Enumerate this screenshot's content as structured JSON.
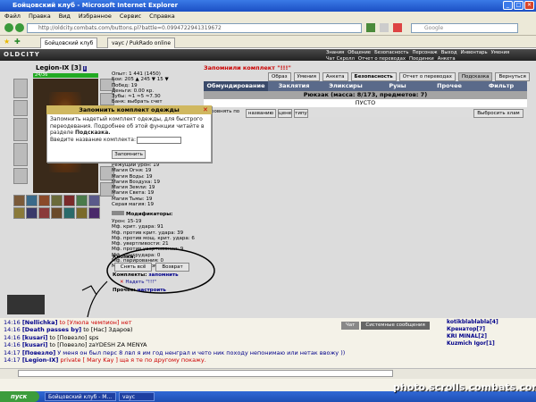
{
  "window": {
    "title": "Бойцовский клуб - Microsoft Internet Explorer"
  },
  "menu": [
    "Файл",
    "Правка",
    "Вид",
    "Избранное",
    "Сервис",
    "Справка"
  ],
  "address": {
    "url": "http://oldcity.combats.com/buttons.pl?battle=0.0994722941319672"
  },
  "search": {
    "placeholder": "Google"
  },
  "browser_tabs": [
    "Бойцовский клуб",
    "vayc / PukRado online"
  ],
  "logo": "OLDCITY",
  "game_nav": [
    "Знания",
    "Общение",
    "Безопасность",
    "Персонаж",
    "Выход",
    "Инвентарь",
    "Умения",
    "Чат Скролл",
    "Отчет о переводах",
    "Поединки",
    "Анкета"
  ],
  "character": {
    "name": "Legion-IX",
    "level": "[3]",
    "hp": "24/36",
    "stats": [
      "Опыт: 1 441 (1450)",
      "Бои: 205 ▲ 245 ▼ 15 ▼",
      "Побед: 19",
      "Деньги: 0.00 кр.",
      "Зубы: ≈1 ≈5 ≈7.30"
    ],
    "bank": "Банк: выбрать счет"
  },
  "stats2": [
    "Режущий урон: 19",
    "Магия Огня: 19",
    "Магия Воды: 19",
    "Магия Воздуха: 19",
    "Магия Земли: 19",
    "Магия Света: 19",
    "Магия Тьмы: 19",
    "Серая магия: 19"
  ],
  "mods_label": "Модификаторы:",
  "mods": [
    "Урон: 15-19",
    "Мф. крит. удара: 91",
    "Мф. против крит. удара: 39",
    "Мф. против мощ. крит. удара: 6",
    "Мф. увертливости: 21",
    "Мф. против увертывания: 9",
    "Мф. контрудара: 0",
    "Мф. парирования: 0",
    "Мф. блока щитом: 0"
  ],
  "kit": {
    "buttons_label": "Кнопки:",
    "undress_all": "Снять всё",
    "return": "Возврат",
    "kits_label": "Комплекты:",
    "remember": "запомнить",
    "wear": "Надеть \"!!!\"",
    "other_label": "Прочее:",
    "settings": "настроить"
  },
  "top_buttons": [
    "Образ",
    "Умения",
    "Анкета",
    "Безопасность",
    "Отчет о переводах",
    "Подсказка",
    "Вернуться"
  ],
  "saved_msg": "Запомнили комплект \"!!!\"",
  "inv_tabs": [
    "Обмундирование",
    "Заклятия",
    "Эликсиры",
    "Руны",
    "Прочее",
    "Фильтр"
  ],
  "backpack": "Рюкзак (масса: 8/173, предметов: 7)",
  "empty": "ПУСТО",
  "sort": {
    "label": "ровнять по",
    "opts": [
      "названию",
      "цене",
      "типу"
    ],
    "choose": "Выбросить хлам"
  },
  "dialog": {
    "title": "Запомнить комплект одежды",
    "text1": "Запомнить надетый комплект одежды, для быстрого",
    "text2": "переодевания. Подробнее об этой функции читайте в",
    "text3": "разделе",
    "link": "Подсказка.",
    "field_label": "Введите название комплекта:",
    "button": "Запомнить"
  },
  "chat": [
    {
      "t": "14:16",
      "n": "[Nellichka]",
      "m": "to [Улюла чемпион] нет"
    },
    {
      "t": "14:16",
      "n": "[Death passes by]",
      "m": "to [Нас] Здаров)"
    },
    {
      "t": "14:16",
      "n": "[kusari]",
      "m": "to [Повезло] sps"
    },
    {
      "t": "14:16",
      "n": "[kusari]",
      "m": "to [Повезло] zaYDESH ZA MENYA"
    },
    {
      "t": "14:17",
      "n": "[Повезло]",
      "m": "У меня он был перс 8 лвл я им год ненграл и чето ник походу непонимаю или нетак ввожу ))"
    },
    {
      "t": "14:17",
      "n": "[Legion-IX]",
      "m": "private [ Mary Kay ] ща я те по другому покажу."
    }
  ],
  "chat_tabs": [
    "Чат",
    "Системные сообщения"
  ],
  "users": [
    "kotikblablabla[4]",
    "Кренатор[7]",
    "KRI MINAL[2]",
    "Kuzmich Igor[1]"
  ],
  "taskbar": {
    "start": "пуск",
    "items": [
      "Бойцовский клуб - M...",
      "vayc"
    ],
    "watermark": "photo.scrolls.combats.com"
  }
}
